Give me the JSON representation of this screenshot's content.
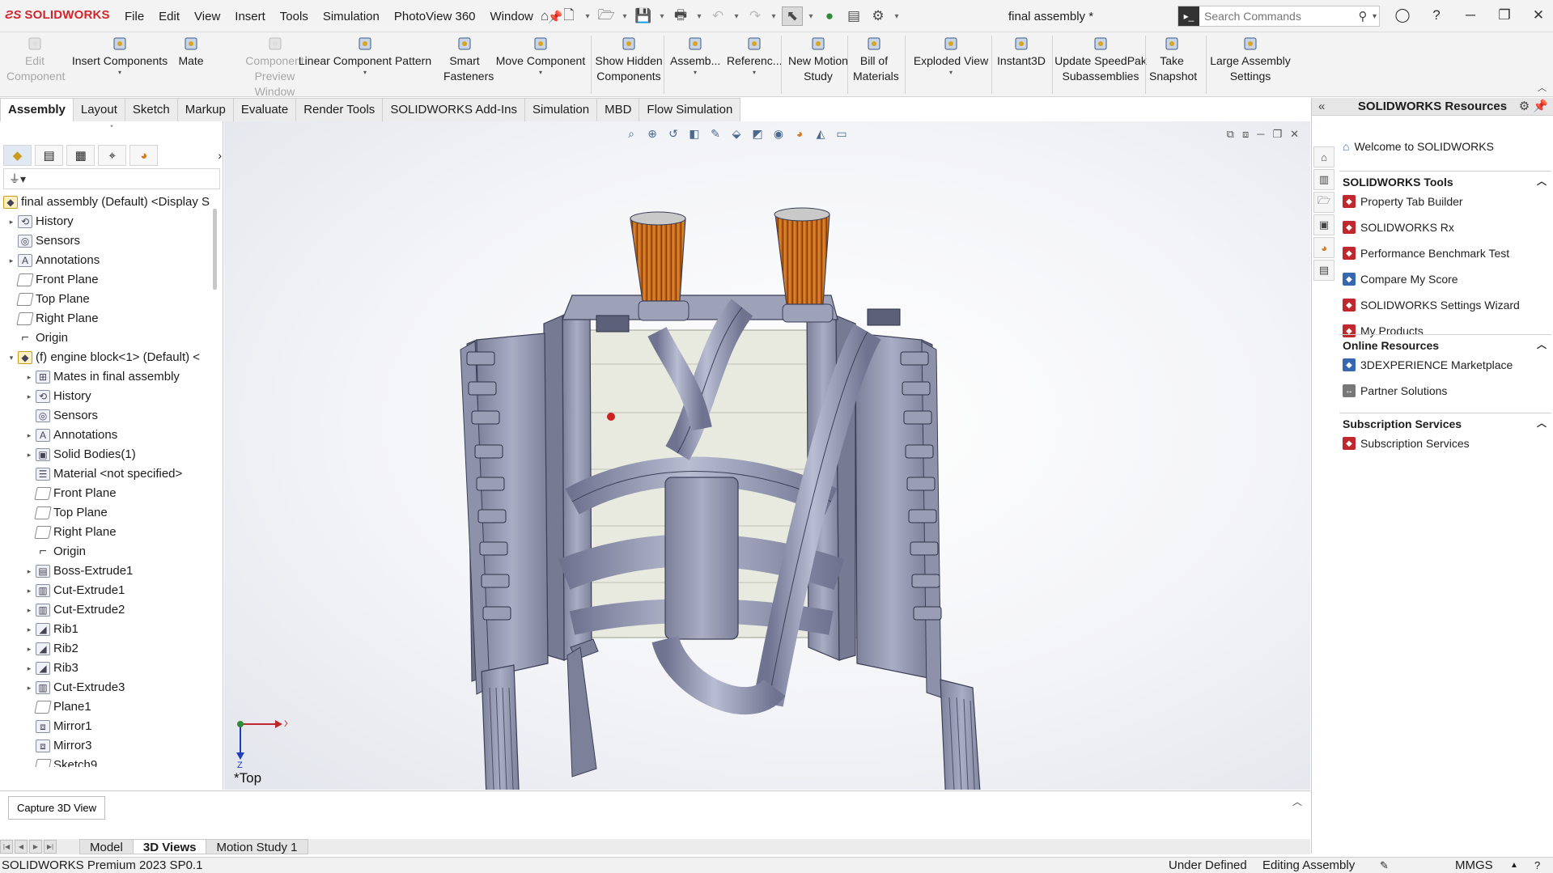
{
  "app": {
    "logo_text": "SOLIDWORKS",
    "document_title": "final assembly *"
  },
  "menu": [
    "File",
    "Edit",
    "View",
    "Insert",
    "Tools",
    "Simulation",
    "PhotoView 360",
    "Window"
  ],
  "search": {
    "placeholder": "Search Commands"
  },
  "command_manager": [
    {
      "label": "Edit\nComponent",
      "enabled": false,
      "icon": "edit-component-icon"
    },
    {
      "label": "Insert Components",
      "enabled": true,
      "icon": "insert-components-icon"
    },
    {
      "label": "Mate",
      "enabled": true,
      "icon": "mate-icon"
    },
    {
      "label": "Component\nPreview Window",
      "enabled": false,
      "icon": "preview-window-icon"
    },
    {
      "label": "Linear Component Pattern",
      "enabled": true,
      "icon": "linear-pattern-icon"
    },
    {
      "label": "Smart\nFasteners",
      "enabled": true,
      "icon": "smart-fasteners-icon"
    },
    {
      "label": "Move Component",
      "enabled": true,
      "icon": "move-component-icon"
    },
    {
      "label": "Show Hidden\nComponents",
      "enabled": true,
      "icon": "show-hidden-icon"
    },
    {
      "label": "Assemb...",
      "enabled": true,
      "icon": "assembly-features-icon"
    },
    {
      "label": "Referenc...",
      "enabled": true,
      "icon": "reference-geometry-icon"
    },
    {
      "label": "New Motion\nStudy",
      "enabled": true,
      "icon": "motion-study-icon"
    },
    {
      "label": "Bill of\nMaterials",
      "enabled": true,
      "icon": "bom-icon"
    },
    {
      "label": "Exploded View",
      "enabled": true,
      "icon": "exploded-view-icon"
    },
    {
      "label": "Instant3D",
      "enabled": true,
      "icon": "instant3d-icon"
    },
    {
      "label": "Update SpeedPak\nSubassemblies",
      "enabled": true,
      "icon": "speedpak-icon"
    },
    {
      "label": "Take\nSnapshot",
      "enabled": true,
      "icon": "camera-icon"
    },
    {
      "label": "Large Assembly\nSettings",
      "enabled": true,
      "icon": "large-assembly-icon"
    }
  ],
  "tabs": [
    "Assembly",
    "Layout",
    "Sketch",
    "Markup",
    "Evaluate",
    "Render Tools",
    "SOLIDWORKS Add-Ins",
    "Simulation",
    "MBD",
    "Flow Simulation"
  ],
  "active_tab": "Assembly",
  "feature_tree": {
    "root": "final assembly (Default) <Display S",
    "items": [
      {
        "label": "History",
        "expandable": true,
        "icon": "history-icon",
        "indent": 0
      },
      {
        "label": "Sensors",
        "expandable": false,
        "icon": "sensors-icon",
        "indent": 0
      },
      {
        "label": "Annotations",
        "expandable": true,
        "icon": "annotations-icon",
        "indent": 0
      },
      {
        "label": "Front Plane",
        "expandable": false,
        "icon": "plane-icon",
        "indent": 0
      },
      {
        "label": "Top Plane",
        "expandable": false,
        "icon": "plane-icon",
        "indent": 0
      },
      {
        "label": "Right Plane",
        "expandable": false,
        "icon": "plane-icon",
        "indent": 0
      },
      {
        "label": "Origin",
        "expandable": false,
        "icon": "origin-icon",
        "indent": 0
      },
      {
        "label": "(f) engine block<1> (Default) <",
        "expandable": true,
        "expanded": true,
        "icon": "part-icon",
        "indent": 0
      },
      {
        "label": "Mates in final assembly",
        "expandable": true,
        "icon": "mates-icon",
        "indent": 1
      },
      {
        "label": "History",
        "expandable": true,
        "icon": "history-icon",
        "indent": 1
      },
      {
        "label": "Sensors",
        "expandable": false,
        "icon": "sensors-icon",
        "indent": 1
      },
      {
        "label": "Annotations",
        "expandable": true,
        "icon": "annotations-icon",
        "indent": 1
      },
      {
        "label": "Solid Bodies(1)",
        "expandable": true,
        "icon": "solid-bodies-icon",
        "indent": 1
      },
      {
        "label": "Material <not specified>",
        "expandable": false,
        "icon": "material-icon",
        "indent": 1
      },
      {
        "label": "Front Plane",
        "expandable": false,
        "icon": "plane-icon",
        "indent": 1
      },
      {
        "label": "Top Plane",
        "expandable": false,
        "icon": "plane-icon",
        "indent": 1
      },
      {
        "label": "Right Plane",
        "expandable": false,
        "icon": "plane-icon",
        "indent": 1
      },
      {
        "label": "Origin",
        "expandable": false,
        "icon": "origin-icon",
        "indent": 1
      },
      {
        "label": "Boss-Extrude1",
        "expandable": true,
        "icon": "extrude-icon",
        "indent": 1
      },
      {
        "label": "Cut-Extrude1",
        "expandable": true,
        "icon": "cut-extrude-icon",
        "indent": 1
      },
      {
        "label": "Cut-Extrude2",
        "expandable": true,
        "icon": "cut-extrude-icon",
        "indent": 1
      },
      {
        "label": "Rib1",
        "expandable": true,
        "icon": "rib-icon",
        "indent": 1
      },
      {
        "label": "Rib2",
        "expandable": true,
        "icon": "rib-icon",
        "indent": 1
      },
      {
        "label": "Rib3",
        "expandable": true,
        "icon": "rib-icon",
        "indent": 1
      },
      {
        "label": "Cut-Extrude3",
        "expandable": true,
        "icon": "cut-extrude-icon",
        "indent": 1
      },
      {
        "label": "Plane1",
        "expandable": false,
        "icon": "plane-icon",
        "indent": 1
      },
      {
        "label": "Mirror1",
        "expandable": false,
        "icon": "mirror-icon",
        "indent": 1
      },
      {
        "label": "Mirror3",
        "expandable": false,
        "icon": "mirror-icon",
        "indent": 1
      },
      {
        "label": "Sketch9",
        "expandable": false,
        "icon": "sketch-icon",
        "indent": 1
      }
    ]
  },
  "graphics": {
    "view_label": "*Top",
    "triad": {
      "x_label": "X",
      "z_label": "Z"
    }
  },
  "resources": {
    "title": "SOLIDWORKS Resources",
    "welcome": "Welcome to SOLIDWORKS",
    "sections": [
      {
        "title": "SOLIDWORKS Tools",
        "items": [
          "Property Tab Builder",
          "SOLIDWORKS Rx",
          "Performance Benchmark Test",
          "Compare My Score",
          "SOLIDWORKS Settings Wizard",
          "My Products"
        ]
      },
      {
        "title": "Online Resources",
        "items": [
          "3DEXPERIENCE Marketplace",
          "Partner Solutions"
        ]
      },
      {
        "title": "Subscription Services",
        "items": [
          "Subscription Services"
        ]
      }
    ]
  },
  "bottom": {
    "capture_button": "Capture 3D View",
    "tabs": [
      "Model",
      "3D Views",
      "Motion Study 1"
    ],
    "active_tab": "3D Views"
  },
  "status": {
    "product": "SOLIDWORKS Premium 2023 SP0.1",
    "definition": "Under Defined",
    "mode": "Editing Assembly",
    "units": "MMGS"
  },
  "colors": {
    "brand_red": "#d1252b",
    "model_body": "#8e93ad",
    "filter_orange": "#d2781f"
  }
}
